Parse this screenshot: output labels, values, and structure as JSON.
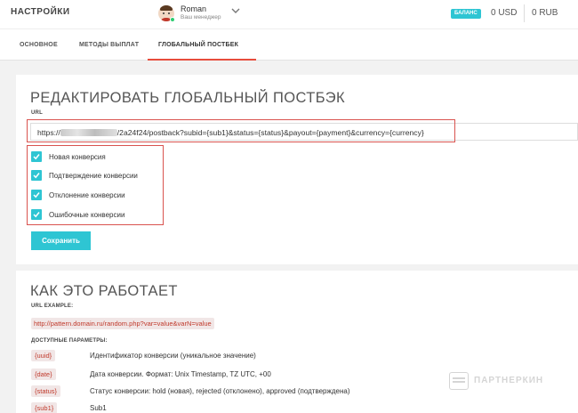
{
  "header": {
    "title": "НАСТРОЙКИ",
    "manager": {
      "name": "Roman",
      "role": "Ваш менеджер"
    },
    "balance": {
      "badge": "БАЛАНС",
      "usd": "0 USD",
      "rub": "0 RUB"
    }
  },
  "tabs": [
    {
      "label": "ОСНОВНОЕ",
      "active": false
    },
    {
      "label": "МЕТОДЫ ВЫПЛАТ",
      "active": false
    },
    {
      "label": "ГЛОБАЛЬНЫЙ ПОСТБЕК",
      "active": true
    }
  ],
  "edit": {
    "title": "РЕДАКТИРОВАТЬ ГЛОБАЛЬНЫЙ ПОСТБЭК",
    "url_label": "URL",
    "url_prefix": "https://",
    "url_suffix": "/2a24f24/postback?subid={sub1}&status={status}&payout={payment}&currency={currency}",
    "checkboxes": [
      {
        "label": "Новая конверсия",
        "checked": true
      },
      {
        "label": "Подтверждение конверсии",
        "checked": true
      },
      {
        "label": "Отклонение конверсии",
        "checked": true
      },
      {
        "label": "Ошибочные конверсии",
        "checked": true
      }
    ],
    "save_label": "Сохранить"
  },
  "how": {
    "title": "КАК ЭТО РАБОТАЕТ",
    "example_label": "URL EXAMPLE:",
    "example_url": "http://pattern.domain.ru/random.php?var=value&varN=value",
    "params_label": "ДОСТУПНЫЕ ПАРАМЕТРЫ:",
    "params": [
      {
        "tag": "{uuid}",
        "desc": "Идентификатор конверсии (уникальное значение)"
      },
      {
        "tag": "{date}",
        "desc": "Дата конверсии. Формат: Unix Timestamp, TZ UTC, +00"
      },
      {
        "tag": "{status}",
        "desc": "Статус конверсии: hold (новая), rejected (отклонено), approved (подтверждена)"
      },
      {
        "tag": "{sub1}",
        "desc": "Sub1"
      }
    ]
  },
  "watermark": "ПАРТНЕРКИН",
  "colors": {
    "accent": "#2ec5d3",
    "highlight": "#d9534f",
    "tab_underline": "#e74c3c",
    "param_text": "#c0392b"
  }
}
